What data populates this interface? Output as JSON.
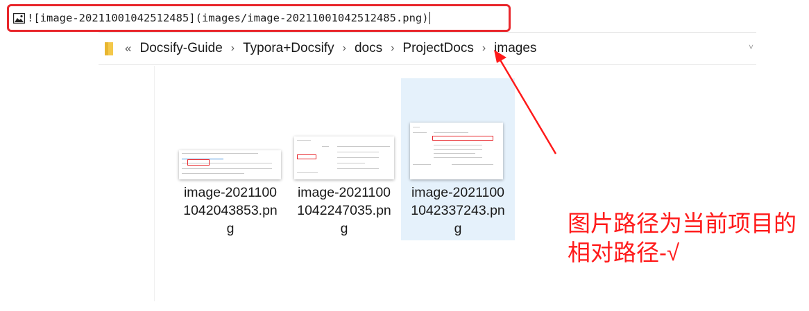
{
  "editor": {
    "markdown_line": "![image-20211001042512485](images/image-20211001042512485.png)"
  },
  "explorer": {
    "breadcrumb": [
      "Docsify-Guide",
      "Typora+Docsify",
      "docs",
      "ProjectDocs",
      "images"
    ],
    "overflow_glyph": "«",
    "files": [
      {
        "name_lines": [
          "image-2021100",
          "1042043853.pn",
          "g"
        ],
        "selected": false
      },
      {
        "name_lines": [
          "image-2021100",
          "1042247035.pn",
          "g"
        ],
        "selected": false
      },
      {
        "name_lines": [
          "image-2021100",
          "1042337243.pn",
          "g"
        ],
        "selected": true
      }
    ]
  },
  "annotation": {
    "lines": [
      "图片路径为当前项目的",
      "相对路径-√"
    ],
    "color": "#ff1a1a"
  },
  "colors": {
    "highlight_border": "#e8262b",
    "selection_bg": "#e5f1fb",
    "folder_yellow": "#f4c84a"
  },
  "icons": [
    "image-icon",
    "folder-icon",
    "chevron-right-icon",
    "overflow-icon"
  ]
}
